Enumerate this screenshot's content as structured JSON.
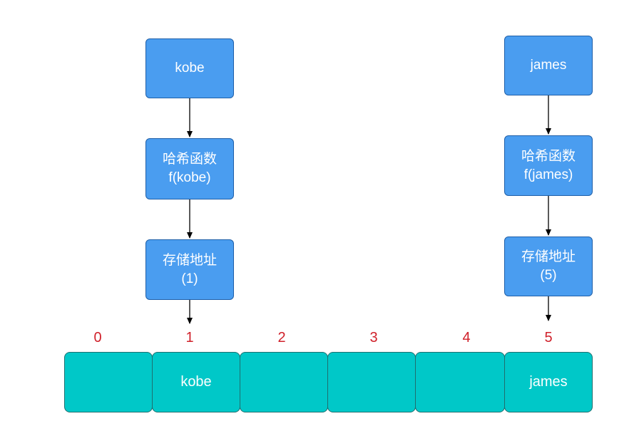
{
  "colors": {
    "node_fill": "#4a9df0",
    "node_border": "#1f5fa8",
    "cell_fill": "#00c8c8",
    "cell_border": "#1f6f6f",
    "index_color": "#d0202a",
    "arrow_color": "#000000"
  },
  "left_flow": {
    "key": "kobe",
    "hash_line1": "哈希函数",
    "hash_line2": "f(kobe)",
    "addr_line1": "存储地址",
    "addr_line2": "(1)"
  },
  "right_flow": {
    "key": "james",
    "hash_line1": "哈希函数",
    "hash_line2": "f(james)",
    "addr_line1": "存储地址",
    "addr_line2": "(5)"
  },
  "array": {
    "indices": [
      "0",
      "1",
      "2",
      "3",
      "4",
      "5"
    ],
    "cells": [
      "",
      "kobe",
      "",
      "",
      "",
      "james"
    ]
  }
}
